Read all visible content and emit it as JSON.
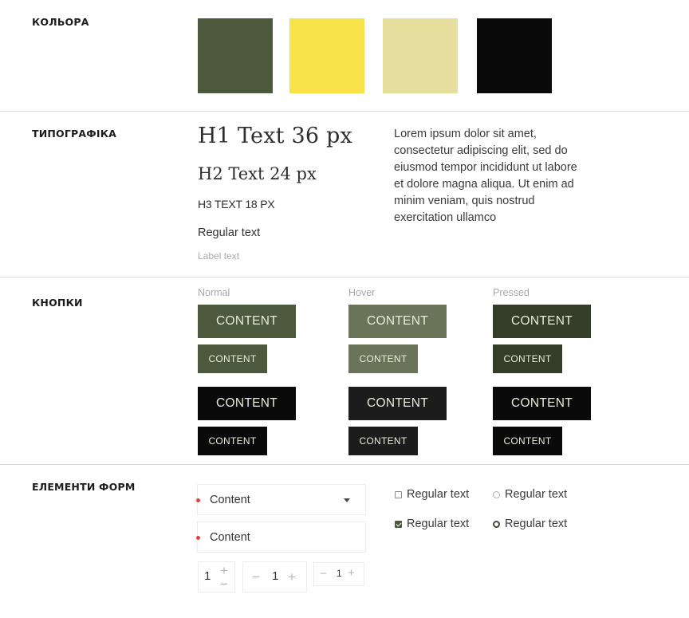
{
  "sections": {
    "colors": {
      "title": "КОЛЬОРА"
    },
    "typography": {
      "title": "ТИПОГРАФІКА"
    },
    "buttons": {
      "title": "КНОПКИ"
    },
    "forms": {
      "title": "ЕЛЕМЕНТИ ФОРМ"
    }
  },
  "palette": [
    {
      "name": "dark-olive",
      "hex": "#4b5a3c"
    },
    {
      "name": "yellow",
      "hex": "#f7e24a"
    },
    {
      "name": "pale-khaki",
      "hex": "#e6df9e"
    },
    {
      "name": "black",
      "hex": "#0a0a0a"
    }
  ],
  "typography": {
    "h1": "H1 Text 36 px",
    "h2": "H2 Text 24 px",
    "h3": "H3 TEXT 18 PX",
    "regular": "Regular text",
    "label": "Label text",
    "paragraph": "Lorem ipsum dolor sit amet, consectetur adipiscing elit, sed do eiusmod tempor incididunt ut labore et dolore magna aliqua. Ut enim ad minim veniam, quis nostrud exercitation ullamco"
  },
  "buttons": {
    "states": [
      "Normal",
      "Hover",
      "Pressed"
    ],
    "label": "CONTENT",
    "colors": {
      "primary": [
        "#4b5a3c",
        "#6a7458",
        "#333d28"
      ],
      "dark": [
        "#0a0a0a",
        "#1c1c1c",
        "#0a0a0a"
      ]
    }
  },
  "forms": {
    "select": {
      "value": "Content",
      "required": true
    },
    "input": {
      "value": "Content",
      "required": true
    },
    "checkboxes": [
      {
        "label": "Regular text",
        "checked": false
      },
      {
        "label": "Regular text",
        "checked": true
      }
    ],
    "radios": [
      {
        "label": "Regular text",
        "checked": false
      },
      {
        "label": "Regular text",
        "checked": true
      }
    ],
    "steppers": [
      {
        "value": "1",
        "plus": "+",
        "minus": "−"
      },
      {
        "value": "1",
        "plus": "+",
        "minus": "−"
      },
      {
        "value": "1",
        "plus": "+",
        "minus": "−"
      }
    ]
  },
  "colors": {
    "required_dot": "#e0423a",
    "divider": "#d9d9d9"
  }
}
